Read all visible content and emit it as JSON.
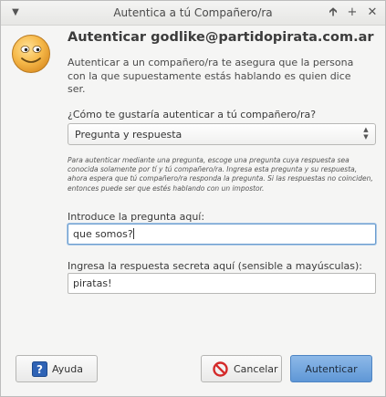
{
  "window": {
    "title": "Autentica a tú Compañero/ra",
    "menu_icon": "chevron-down-icon",
    "buttons": [
      "arrow-up-icon",
      "maximize-icon",
      "close-icon"
    ]
  },
  "header": {
    "icon": "smiley-face-icon",
    "title": "Autenticar godlike@partidopirata.com.ar",
    "intro": "Autenticar a un compañero/ra te asegura que la persona con la que supuestamente estás hablando es quien dice ser."
  },
  "method": {
    "label": "¿Cómo te gustaría autenticar a tú compañero/ra?",
    "selected": "Pregunta y respuesta"
  },
  "help_text": "Para autenticar mediante una pregunta, escoge una pregunta cuya respuesta sea conocida solamente por tí y tú compañero/ra. Ingresa esta pregunta y su respuesta, ahora espera que tú compañero/ra responda la pregunta. Si las respuestas no coinciden, entonces puede ser que estés hablando con un impostor.",
  "question": {
    "label": "Introduce la pregunta aquí:",
    "value": "que somos?"
  },
  "answer": {
    "label": "Ingresa la respuesta secreta aquí (sensible a mayúsculas):",
    "value": "piratas!"
  },
  "buttons": {
    "help": "Ayuda",
    "cancel": "Cancelar",
    "authenticate": "Autenticar"
  },
  "colors": {
    "accent": "#5f97d6",
    "focus": "#6c9ecf",
    "face": "#f2a93b"
  }
}
